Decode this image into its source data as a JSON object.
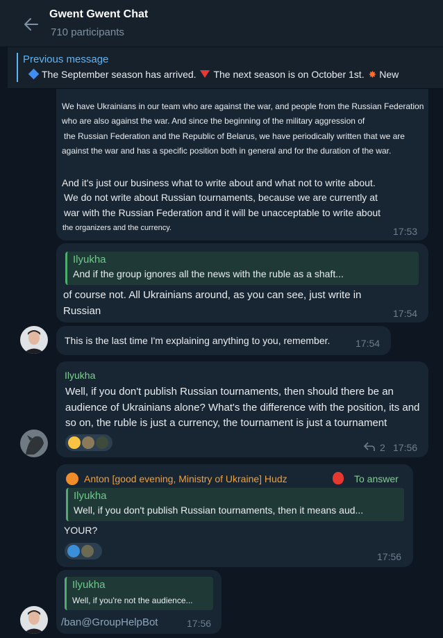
{
  "header": {
    "title": "Gwent Gwent Chat",
    "participants": "710 participants"
  },
  "pinned": {
    "label": "Previous message",
    "part1": "The September season has arrived.",
    "part2": "The next season is on October 1st.",
    "part3": "New"
  },
  "messages": {
    "m1": {
      "line1": "We have Ukrainians in our team who are against the war, and people from the Russian Federation",
      "line2": "who are also against the war. And since the beginning of the military aggression of",
      "line3": "the Russian Federation and the Republic of Belarus, we have periodically written that we are",
      "line4": "against the war and has a specific position both in general and for the duration of the war.",
      "line5": "And it's just our business what to write about and what not to write about.",
      "line6": "We do not write about Russian tournaments, because we are currently at",
      "line7": "war with the Russian Federation and it will be unacceptable to write about",
      "line8": "the organizers and the currency.",
      "time": "17:53"
    },
    "m2": {
      "reply_name": "Ilyukha",
      "reply_text": "And if the group ignores all the news with the ruble as a shaft...",
      "line1": "of course not. All Ukrainians around, as you can see, just write in",
      "line2": "Russian",
      "time": "17:54"
    },
    "m3": {
      "text": "This is the last time I'm explaining anything to you, remember.",
      "time": "17:54"
    },
    "m4": {
      "sender": "Ilyukha",
      "line1": "Well, if you don't publish Russian tournaments, then should there be an",
      "line2": "audience of Ukrainians alone? What's the difference with the position, its and",
      "line3": "so on, the ruble is just a currency, the tournament is just a tournament",
      "reply_count": "2",
      "time": "17:56"
    },
    "m5": {
      "sender": "Anton [good evening, Ministry of Ukraine] Hudz",
      "to_answer": "To answer",
      "reply_name": "Ilyukha",
      "reply_text": "Well, if you don't publish Russian tournaments, then it means aud...",
      "text": "YOUR?",
      "time": "17:56"
    },
    "m6": {
      "reply_name": "Ilyukha",
      "reply_text": "Well, if you're not the audience...",
      "text": "/ban@GroupHelpBot",
      "time": "17:56"
    }
  },
  "colors": {
    "background": "#0e1621",
    "bubble": "#182533",
    "accent": "#5eb5f7",
    "reply_green": "#4fae6d"
  }
}
